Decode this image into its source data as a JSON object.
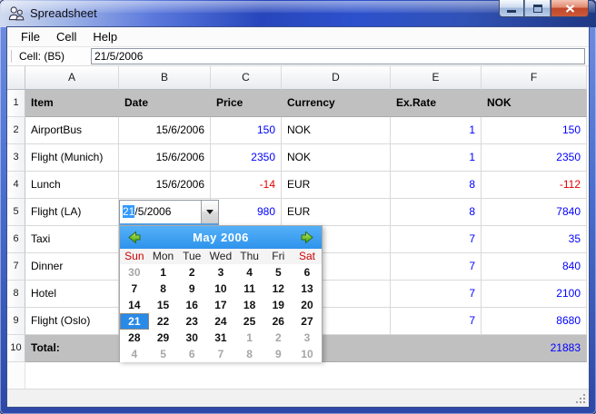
{
  "window": {
    "title": "Spreadsheet"
  },
  "menu": {
    "items": [
      "File",
      "Cell",
      "Help"
    ]
  },
  "toolbar": {
    "cell_label": "Cell: (B5)",
    "cell_value": "21/5/2006"
  },
  "spreadsheet": {
    "column_headers": [
      "A",
      "B",
      "C",
      "D",
      "E",
      "F"
    ],
    "row_numbers": [
      "1",
      "2",
      "3",
      "4",
      "5",
      "6",
      "7",
      "8",
      "9",
      "10"
    ],
    "rows": [
      {
        "shaded": true,
        "cells": [
          {
            "t": "Item",
            "a": "l",
            "b": true
          },
          {
            "t": "Date",
            "a": "l",
            "b": true
          },
          {
            "t": "Price",
            "a": "l",
            "b": true
          },
          {
            "t": "Currency",
            "a": "l",
            "b": true
          },
          {
            "t": "Ex.Rate",
            "a": "l",
            "b": true
          },
          {
            "t": "NOK",
            "a": "l",
            "b": true
          }
        ]
      },
      {
        "cells": [
          {
            "t": "AirportBus",
            "a": "l"
          },
          {
            "t": "15/6/2006",
            "a": "r"
          },
          {
            "t": "150",
            "a": "r",
            "c": "blue"
          },
          {
            "t": "NOK",
            "a": "l"
          },
          {
            "t": "1",
            "a": "r",
            "c": "blue"
          },
          {
            "t": "150",
            "a": "r",
            "c": "blue"
          }
        ]
      },
      {
        "cells": [
          {
            "t": "Flight (Munich)",
            "a": "l"
          },
          {
            "t": "15/6/2006",
            "a": "r"
          },
          {
            "t": "2350",
            "a": "r",
            "c": "blue"
          },
          {
            "t": "NOK",
            "a": "l"
          },
          {
            "t": "1",
            "a": "r",
            "c": "blue"
          },
          {
            "t": "2350",
            "a": "r",
            "c": "blue"
          }
        ]
      },
      {
        "cells": [
          {
            "t": "Lunch",
            "a": "l"
          },
          {
            "t": "15/6/2006",
            "a": "r"
          },
          {
            "t": "-14",
            "a": "r",
            "c": "red"
          },
          {
            "t": "EUR",
            "a": "l"
          },
          {
            "t": "8",
            "a": "r",
            "c": "blue"
          },
          {
            "t": "-112",
            "a": "r",
            "c": "red"
          }
        ]
      },
      {
        "cells": [
          {
            "t": "Flight (LA)",
            "a": "l"
          },
          {
            "t": "",
            "a": "r"
          },
          {
            "t": "980",
            "a": "r",
            "c": "blue"
          },
          {
            "t": "EUR",
            "a": "l"
          },
          {
            "t": "8",
            "a": "r",
            "c": "blue"
          },
          {
            "t": "7840",
            "a": "r",
            "c": "blue"
          }
        ]
      },
      {
        "cells": [
          {
            "t": "Taxi",
            "a": "l"
          },
          {
            "t": "",
            "a": "l"
          },
          {
            "t": "",
            "a": "l"
          },
          {
            "t": "",
            "a": "l"
          },
          {
            "t": "7",
            "a": "r",
            "c": "blue"
          },
          {
            "t": "35",
            "a": "r",
            "c": "blue"
          }
        ]
      },
      {
        "cells": [
          {
            "t": "Dinner",
            "a": "l"
          },
          {
            "t": "",
            "a": "l"
          },
          {
            "t": "",
            "a": "l"
          },
          {
            "t": "",
            "a": "l"
          },
          {
            "t": "7",
            "a": "r",
            "c": "blue"
          },
          {
            "t": "840",
            "a": "r",
            "c": "blue"
          }
        ]
      },
      {
        "cells": [
          {
            "t": "Hotel",
            "a": "l"
          },
          {
            "t": "",
            "a": "l"
          },
          {
            "t": "",
            "a": "l"
          },
          {
            "t": "",
            "a": "l"
          },
          {
            "t": "7",
            "a": "r",
            "c": "blue"
          },
          {
            "t": "2100",
            "a": "r",
            "c": "blue"
          }
        ]
      },
      {
        "cells": [
          {
            "t": "Flight (Oslo)",
            "a": "l"
          },
          {
            "t": "",
            "a": "l"
          },
          {
            "t": "",
            "a": "l"
          },
          {
            "t": "",
            "a": "l"
          },
          {
            "t": "7",
            "a": "r",
            "c": "blue"
          },
          {
            "t": "8680",
            "a": "r",
            "c": "blue"
          }
        ]
      },
      {
        "shaded": true,
        "cells": [
          {
            "t": "Total:",
            "a": "l",
            "b": true
          },
          {
            "t": "",
            "a": "l"
          },
          {
            "t": "",
            "a": "l"
          },
          {
            "t": "",
            "a": "l"
          },
          {
            "t": "",
            "a": "l"
          },
          {
            "t": "21883",
            "a": "r",
            "c": "blue"
          }
        ]
      }
    ]
  },
  "date_editor": {
    "selected": "21",
    "rest": "/5/2006",
    "full_value": "21/5/2006"
  },
  "calendar": {
    "title": "May 2006",
    "day_names": [
      {
        "t": "Sun",
        "s": "r"
      },
      {
        "t": "Mon"
      },
      {
        "t": "Tue"
      },
      {
        "t": "Wed"
      },
      {
        "t": "Thu"
      },
      {
        "t": "Fri"
      },
      {
        "t": "Sat",
        "s": "r"
      }
    ],
    "weeks": [
      [
        {
          "t": "30",
          "s": "m"
        },
        {
          "t": "1"
        },
        {
          "t": "2"
        },
        {
          "t": "3"
        },
        {
          "t": "4"
        },
        {
          "t": "5"
        },
        {
          "t": "6",
          "s": "r"
        }
      ],
      [
        {
          "t": "7",
          "s": "r"
        },
        {
          "t": "8"
        },
        {
          "t": "9"
        },
        {
          "t": "10"
        },
        {
          "t": "11"
        },
        {
          "t": "12"
        },
        {
          "t": "13",
          "s": "r"
        }
      ],
      [
        {
          "t": "14",
          "s": "r"
        },
        {
          "t": "15"
        },
        {
          "t": "16"
        },
        {
          "t": "17"
        },
        {
          "t": "18"
        },
        {
          "t": "19"
        },
        {
          "t": "20",
          "s": "r"
        }
      ],
      [
        {
          "t": "21",
          "s": "sel"
        },
        {
          "t": "22"
        },
        {
          "t": "23"
        },
        {
          "t": "24"
        },
        {
          "t": "25"
        },
        {
          "t": "26"
        },
        {
          "t": "27",
          "s": "r"
        }
      ],
      [
        {
          "t": "28",
          "s": "r"
        },
        {
          "t": "29"
        },
        {
          "t": "30"
        },
        {
          "t": "31"
        },
        {
          "t": "1",
          "s": "m"
        },
        {
          "t": "2",
          "s": "m"
        },
        {
          "t": "3",
          "s": "m"
        }
      ],
      [
        {
          "t": "4",
          "s": "m"
        },
        {
          "t": "5",
          "s": "m"
        },
        {
          "t": "6",
          "s": "m"
        },
        {
          "t": "7",
          "s": "m"
        },
        {
          "t": "8",
          "s": "m"
        },
        {
          "t": "9",
          "s": "m"
        },
        {
          "t": "10",
          "s": "m"
        }
      ]
    ],
    "selected_day": "21"
  },
  "icons": [
    "app-icon",
    "minimize-icon",
    "maximize-icon",
    "close-icon",
    "dropdown-arrow-icon",
    "prev-month-icon",
    "next-month-icon",
    "resize-grip-icon"
  ],
  "colors": {
    "positive_number": "#0000ff",
    "negative_number": "#e60000",
    "header_row_bg": "#c0c0c0",
    "calendar_header_blue": "#2e93ec",
    "selected_day_bg": "#2a8ae8",
    "weekend_red": "#cc0000",
    "muted_day_gray": "#a6a6a6",
    "titlebar_blue": "#2b50c8",
    "selection_blue": "#3399ff"
  }
}
